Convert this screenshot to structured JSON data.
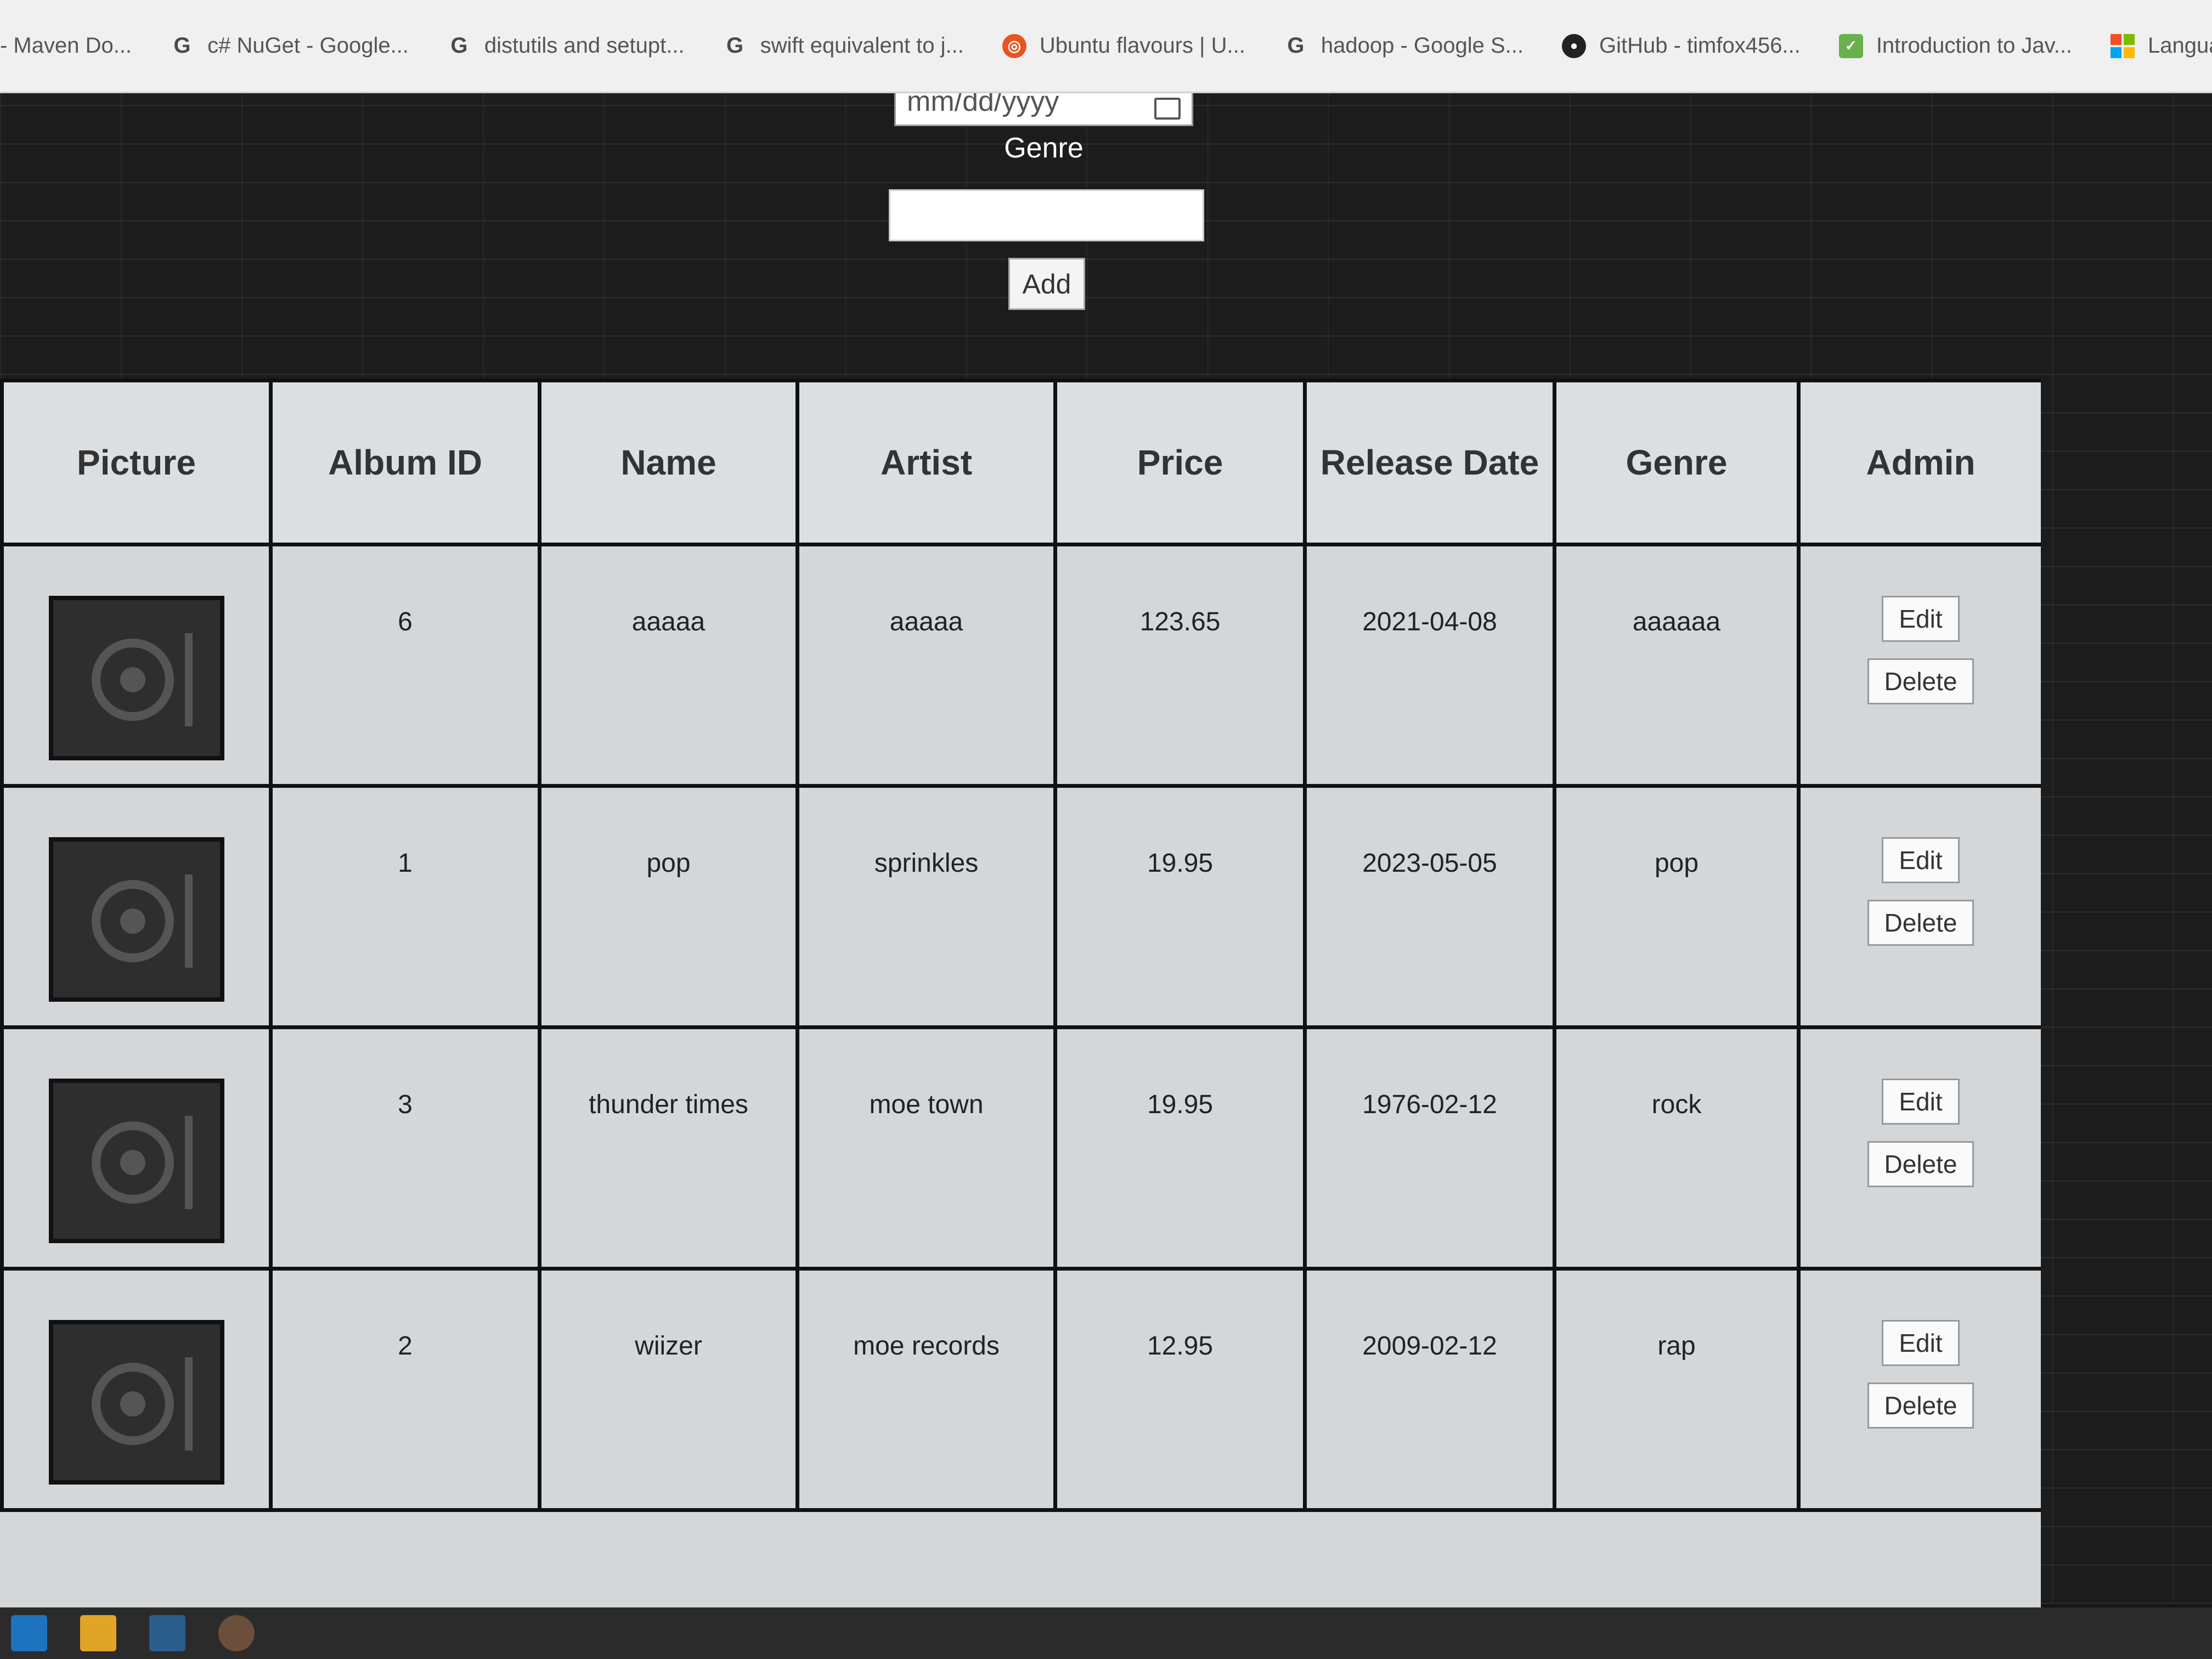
{
  "bookmarks": [
    {
      "label": "- Maven Do...",
      "icon": "none"
    },
    {
      "label": "c# NuGet - Google...",
      "icon": "google-icon"
    },
    {
      "label": "distutils and setupt...",
      "icon": "google-icon"
    },
    {
      "label": "swift equivalent to j...",
      "icon": "google-icon"
    },
    {
      "label": "Ubuntu flavours | U...",
      "icon": "ubuntu-icon"
    },
    {
      "label": "hadoop - Google S...",
      "icon": "google-icon"
    },
    {
      "label": "GitHub - timfox456...",
      "icon": "github-icon"
    },
    {
      "label": "Introduction to Jav...",
      "icon": "leaf-icon"
    },
    {
      "label": "Language-I",
      "icon": "windows-icon"
    }
  ],
  "form": {
    "date_placeholder": "mm/dd/yyyy",
    "genre_label": "Genre",
    "genre_value": "",
    "add_label": "Add"
  },
  "table": {
    "headers": [
      "Picture",
      "Album ID",
      "Name",
      "Artist",
      "Price",
      "Release Date",
      "Genre",
      "Admin"
    ],
    "rows": [
      {
        "id": "6",
        "name": "aaaaa",
        "artist": "aaaaa",
        "price": "123.65",
        "release_date": "2021-04-08",
        "genre": "aaaaaa"
      },
      {
        "id": "1",
        "name": "pop",
        "artist": "sprinkles",
        "price": "19.95",
        "release_date": "2023-05-05",
        "genre": "pop"
      },
      {
        "id": "3",
        "name": "thunder times",
        "artist": "moe town",
        "price": "19.95",
        "release_date": "1976-02-12",
        "genre": "rock"
      },
      {
        "id": "2",
        "name": "wiizer",
        "artist": "moe records",
        "price": "12.95",
        "release_date": "2009-02-12",
        "genre": "rap"
      }
    ],
    "edit_label": "Edit",
    "delete_label": "Delete"
  },
  "colors": {
    "background": "#1c1c1c",
    "table_bg": "#d4d7da",
    "grid_lines": "#111111",
    "album_art": "#2e2e2e"
  }
}
